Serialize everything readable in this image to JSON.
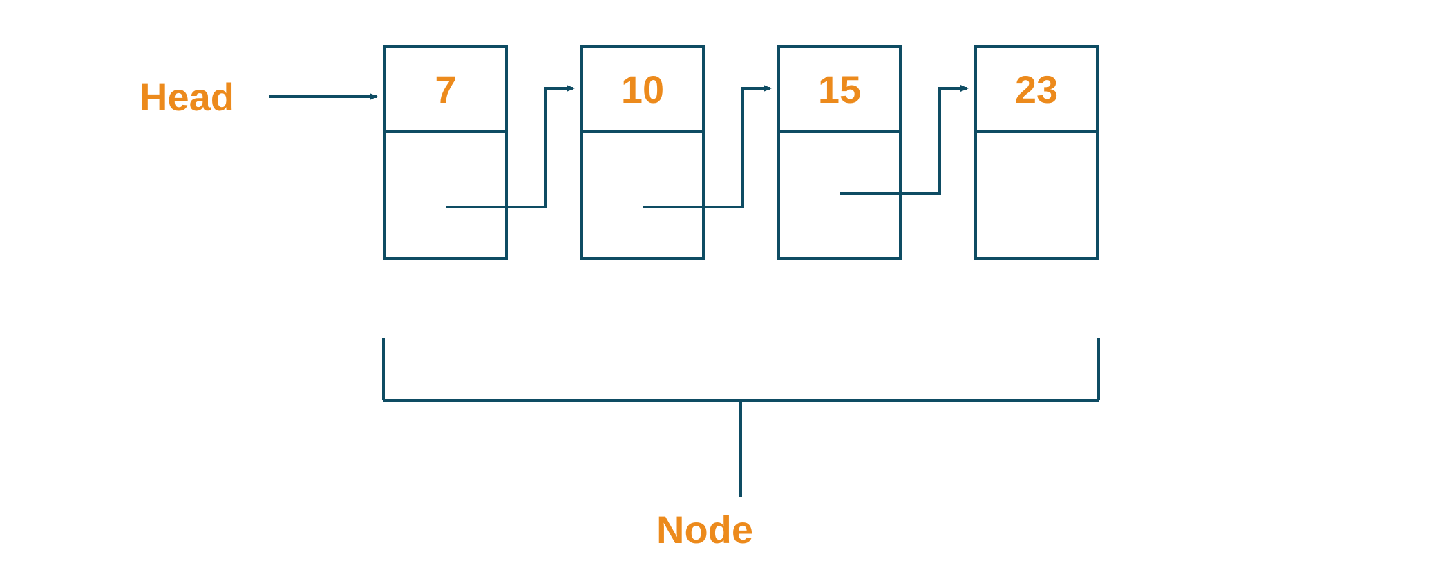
{
  "labels": {
    "head": "Head",
    "node": "Node"
  },
  "nodes": [
    {
      "value": "7"
    },
    {
      "value": "10"
    },
    {
      "value": "15"
    },
    {
      "value": "23"
    }
  ],
  "colors": {
    "accent": "#ec8a1c",
    "line": "#0e4c63"
  }
}
